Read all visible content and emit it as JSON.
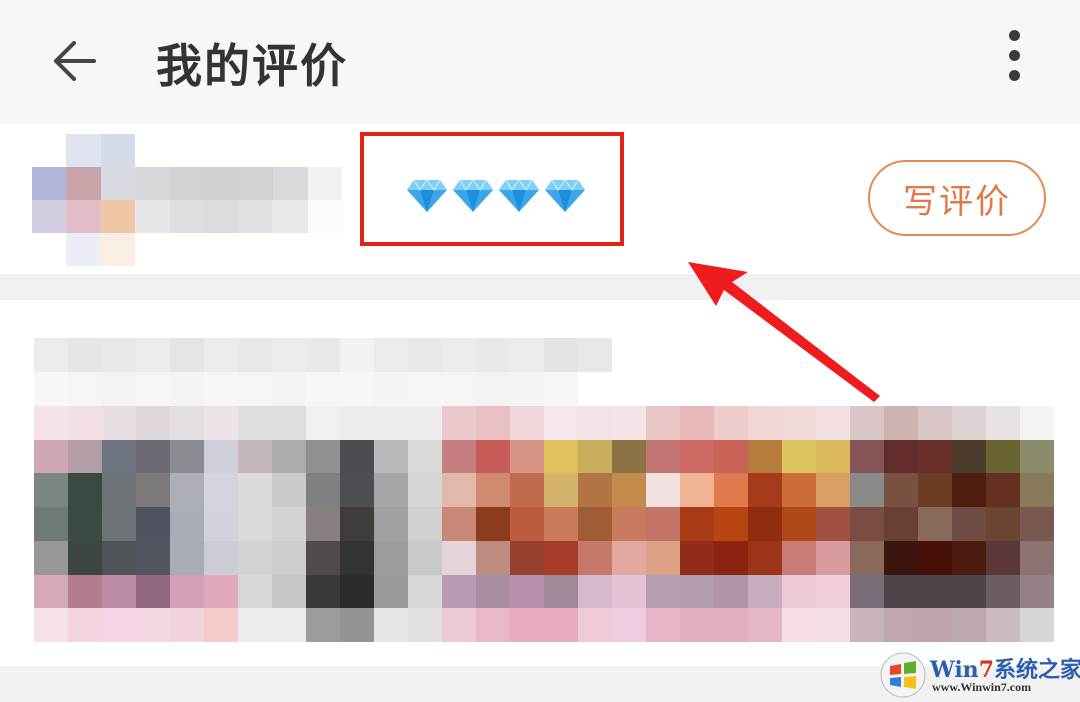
{
  "header": {
    "title": "我的评价",
    "back_icon": "arrow-left-icon",
    "more_icon": "more-vertical-icon"
  },
  "review": {
    "rating": 4,
    "rating_icon": "diamond-icon",
    "rating_max_shown": 4,
    "write_review_label": "写评价",
    "accent_color": "#e07a45",
    "highlight_color": "#e8201a"
  },
  "watermark": {
    "name_prefix": "Win",
    "name_seven": "7",
    "name_suffix": "系统之家",
    "url": "www.Winwin7.com"
  }
}
